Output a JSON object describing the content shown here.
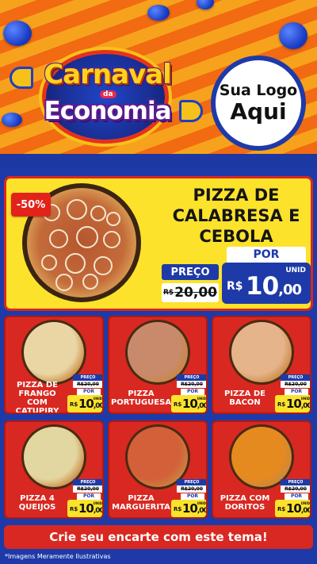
{
  "header": {
    "campaign_line1": "Carnaval",
    "campaign_da": "da",
    "campaign_line2": "Economia",
    "brand_line1": "Sua Logo",
    "brand_line2": "Aqui"
  },
  "featured": {
    "discount": "-50%",
    "name": "PIZZA DE CALABRESA E CEBOLA",
    "preco_label": "PREÇO",
    "old_currency": "R$",
    "old_value": "20,00",
    "por_label": "POR",
    "unid_label": "UNID",
    "currency": "R$",
    "price_int": "10",
    "price_cents": ",00"
  },
  "products": [
    {
      "name": "PIZZA DE FRANGO COM CATUPIRY",
      "preco_label": "PREÇO",
      "old_price": "R$20,00",
      "por_label": "POR",
      "currency": "R$",
      "price_int": "10",
      "price_cents": ",00",
      "unid_label": "UNID",
      "topping_color": "#e9d6a4"
    },
    {
      "name": "PIZZA PORTUGUESA",
      "preco_label": "PREÇO",
      "old_price": "R$20,00",
      "por_label": "POR",
      "currency": "R$",
      "price_int": "10",
      "price_cents": ",00",
      "unid_label": "UNID",
      "topping_color": "#c98a6c"
    },
    {
      "name": "PIZZA DE BACON",
      "preco_label": "PREÇO",
      "old_price": "R$20,00",
      "por_label": "POR",
      "currency": "R$",
      "price_int": "10",
      "price_cents": ",00",
      "unid_label": "UNID",
      "topping_color": "#e6b48a"
    },
    {
      "name": "PIZZA 4 QUEIJOS",
      "preco_label": "PREÇO",
      "old_price": "R$20,00",
      "por_label": "POR",
      "currency": "R$",
      "price_int": "10",
      "price_cents": ",00",
      "unid_label": "UNID",
      "topping_color": "#e3d7a1"
    },
    {
      "name": "PIZZA MARGUERITA",
      "preco_label": "PREÇO",
      "old_price": "R$20,00",
      "por_label": "POR",
      "currency": "R$",
      "price_int": "10",
      "price_cents": ",00",
      "unid_label": "UNID",
      "topping_color": "#d4603a"
    },
    {
      "name": "PIZZA COM DORITOS",
      "preco_label": "PREÇO",
      "old_price": "R$20,00",
      "por_label": "POR",
      "currency": "R$",
      "price_int": "10",
      "price_cents": ",00",
      "unid_label": "UNID",
      "topping_color": "#e58a1f"
    }
  ],
  "cta": "Crie seu encarte com este tema!",
  "disclaimer": "*Imagens Meramente Ilustrativas",
  "colors": {
    "blue": "#1e3aa8",
    "red": "#d82821",
    "yellow": "#fce22b",
    "orange": "#f26a12"
  }
}
